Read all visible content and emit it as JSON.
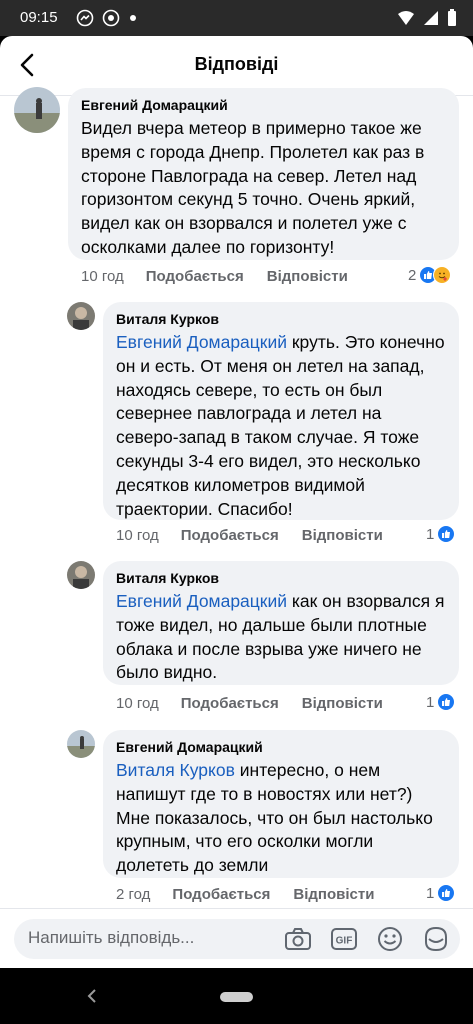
{
  "status_bar": {
    "time": "09:15"
  },
  "header": {
    "title": "Відповіді"
  },
  "comments": [
    {
      "author": "Евгений Домарацкий",
      "text": "Видел вчера метеор в примерно такое же время с города Днепр. Пролетел как раз в стороне Павлограда на север. Летел над горизонтом секунд 5 точно. Очень яркий, видел как он взорвался и полетел уже с осколками далее по горизонту!",
      "time": "10 год",
      "like_label": "Подобається",
      "reply_label": "Відповісти",
      "reaction_count": "2"
    },
    {
      "author": "Виталя Курков",
      "mention": "Евгений Домарацкий",
      "text": " круть. Это конечно он и есть. От меня он летел на запад, находясь севере, то есть он был севернее павлограда и летел на северо-запад в таком случае. Я тоже секунды 3-4 его видел, это несколько десятков километров видимой траектории. Спасибо!",
      "time": "10 год",
      "like_label": "Подобається",
      "reply_label": "Відповісти",
      "reaction_count": "1"
    },
    {
      "author": "Виталя Курков",
      "mention": "Евгений Домарацкий",
      "text": " как он взорвался я тоже видел, но дальше были плотные облака и после взрыва уже ничего не было видно.",
      "time": "10 год",
      "like_label": "Подобається",
      "reply_label": "Відповісти",
      "reaction_count": "1"
    },
    {
      "author": "Евгений Домарацкий",
      "mention": "Виталя Курков",
      "text": " интересно, о нем напишут где то в новостях или нет?) Мне показалось, что он был настолько крупным, что его осколки могли долететь до земли",
      "time": "2 год",
      "like_label": "Подобається",
      "reply_label": "Відповісти",
      "reaction_count": "1"
    }
  ],
  "composer": {
    "placeholder": "Напишіть відповідь...",
    "icons": [
      "camera-icon",
      "gif-icon",
      "emoji-icon",
      "sticker-icon"
    ]
  },
  "colors": {
    "accent": "#1877f2",
    "mention": "#1a5fbf",
    "bubble": "#f0f2f5",
    "meta": "#65676b"
  }
}
